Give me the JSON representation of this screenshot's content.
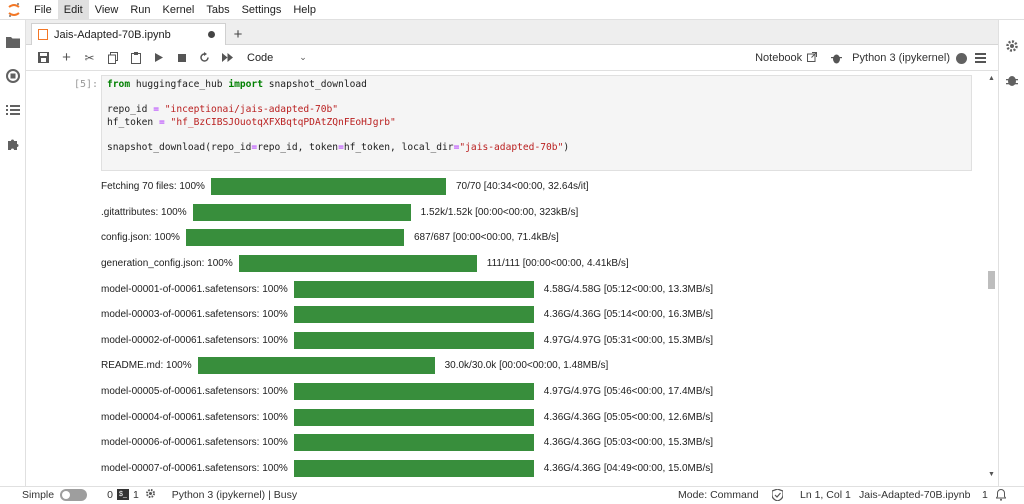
{
  "menubar": {
    "items": [
      "File",
      "Edit",
      "View",
      "Run",
      "Kernel",
      "Tabs",
      "Settings",
      "Help"
    ]
  },
  "tab": {
    "title": "Jais-Adapted-70B.ipynb"
  },
  "toolbar": {
    "cell_type": "Code",
    "notebook_label": "Notebook",
    "kernel_name": "Python 3 (ipykernel)"
  },
  "cell": {
    "prompt": "[5]:",
    "code": {
      "line1": {
        "kw1": "from",
        "mod": " huggingface_hub ",
        "kw2": "import",
        "rest": " snapshot_download"
      },
      "line3": {
        "a": "repo_id ",
        "op": "=",
        "b": " ",
        "s": "\"inceptionai/jais-adapted-70b\""
      },
      "line4": {
        "a": "hf_token ",
        "op": "=",
        "b": " ",
        "s": "\"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\""
      },
      "line6": {
        "a": "snapshot_download(repo_id",
        "op1": "=",
        "b": "repo_id, token",
        "op2": "=",
        "c": "hf_token, local_dir",
        "op3": "=",
        "s": "\"jais-adapted-70b\"",
        "d": ")"
      }
    }
  },
  "outputs": [
    {
      "label": "Fetching 70 files: 100%",
      "progress": 1.0,
      "tail": "70/70 [40:34<00:00, 32.64s/it]"
    },
    {
      "label": ".gitattributes: 100%",
      "progress": 1.0,
      "tail": "1.52k/1.52k [00:00<00:00, 323kB/s]"
    },
    {
      "label": "config.json: 100%",
      "progress": 1.0,
      "tail": "687/687 [00:00<00:00, 71.4kB/s]"
    },
    {
      "label": "generation_config.json: 100%",
      "progress": 1.0,
      "tail": "111/111 [00:00<00:00, 4.41kB/s]"
    },
    {
      "label": "model-00001-of-00061.safetensors: 100%",
      "progress": 1.0,
      "tail": "4.58G/4.58G [05:12<00:00, 13.3MB/s]"
    },
    {
      "label": "model-00003-of-00061.safetensors: 100%",
      "progress": 1.0,
      "tail": "4.36G/4.36G [05:14<00:00, 16.3MB/s]"
    },
    {
      "label": "model-00002-of-00061.safetensors: 100%",
      "progress": 1.0,
      "tail": "4.97G/4.97G [05:31<00:00, 15.3MB/s]"
    },
    {
      "label": "README.md: 100%",
      "progress": 1.0,
      "tail": "30.0k/30.0k [00:00<00:00, 1.48MB/s]"
    },
    {
      "label": "model-00005-of-00061.safetensors: 100%",
      "progress": 1.0,
      "tail": "4.97G/4.97G [05:46<00:00, 17.4MB/s]"
    },
    {
      "label": "model-00004-of-00061.safetensors: 100%",
      "progress": 1.0,
      "tail": "4.36G/4.36G [05:05<00:00, 12.6MB/s]"
    },
    {
      "label": "model-00006-of-00061.safetensors: 100%",
      "progress": 1.0,
      "tail": "4.36G/4.36G [05:03<00:00, 15.3MB/s]"
    },
    {
      "label": "model-00007-of-00061.safetensors: 100%",
      "progress": 1.0,
      "tail": "4.36G/4.36G [04:49<00:00, 15.0MB/s]"
    }
  ],
  "statusbar": {
    "simple_label": "Simple",
    "terminals_count": "0",
    "kernels_count": "1",
    "kernel_status": "Python 3 (ipykernel) | Busy",
    "mode": "Mode: Command",
    "cursor": "Ln 1, Col 1",
    "filename": "Jais-Adapted-70B.ipynb",
    "notifications": "1"
  },
  "colors": {
    "progress_bar": "#388e3c",
    "jupyter_orange": "#f37726"
  }
}
